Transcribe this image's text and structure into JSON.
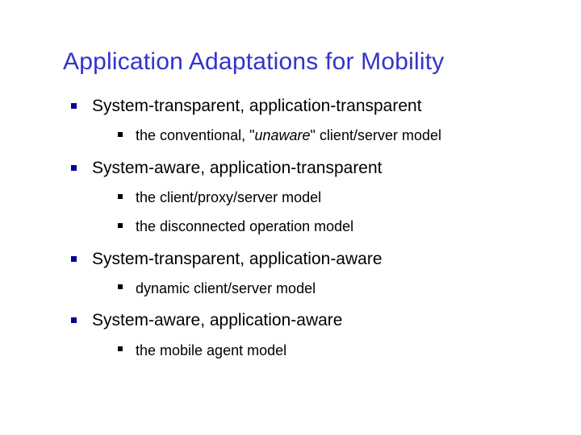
{
  "title": "Application Adaptations for Mobility",
  "items": [
    {
      "label": "System-transparent, application-transparent",
      "sub": [
        {
          "prefix": "the conventional, \"",
          "em": "unaware",
          "suffix": "\" client/server model"
        }
      ]
    },
    {
      "label": "System-aware, application-transparent",
      "sub": [
        {
          "text": "the client/proxy/server model"
        },
        {
          "text": "the disconnected operation model"
        }
      ]
    },
    {
      "label": "System-transparent, application-aware",
      "sub": [
        {
          "text": "dynamic client/server model"
        }
      ]
    },
    {
      "label": "System-aware, application-aware",
      "sub": [
        {
          "text": "the mobile agent model"
        }
      ]
    }
  ]
}
